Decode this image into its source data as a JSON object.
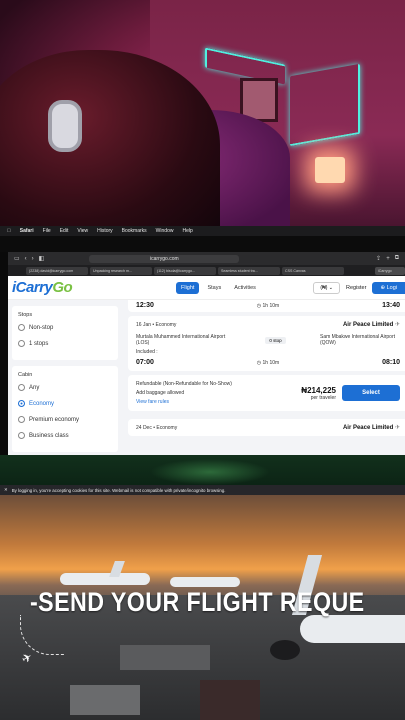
{
  "menubar": {
    "items": [
      "Safari",
      "File",
      "Edit",
      "View",
      "History",
      "Bookmarks",
      "Window",
      "Help"
    ]
  },
  "browser": {
    "url": "icarrygo.com",
    "tabs": [
      "(2238) david@icarrygo.com",
      "Unpacking research m...",
      "(112) bisola@icarrygo...",
      "Seamless student tra...",
      "CSS Canvas"
    ],
    "right_tab": "iCarrygo"
  },
  "site": {
    "logo_main": "iCarry",
    "logo_accent": "Go",
    "nav": [
      "Flight",
      "Stays",
      "Activities"
    ],
    "nav_active": "Flight",
    "currency": "(₦)",
    "register": "Register",
    "login": "Logi"
  },
  "sidebar": {
    "stops_title": "Stops",
    "stops": [
      "Non-stop",
      "1 stops"
    ],
    "cabin_title": "Cabin",
    "cabin": [
      "Any",
      "Economy",
      "Premium economy",
      "Business class"
    ],
    "cabin_selected": "Economy"
  },
  "results": {
    "prev_card": {
      "depart_time": "12:30",
      "duration": "1h 10m",
      "arrive_time": "13:40"
    },
    "card": {
      "date": "16 Jan",
      "cabin": "Economy",
      "airline": "Air Peace Limited",
      "from": "Murtala Muhammed International Airport (LOS)",
      "stops": "0 stop",
      "to": "Sam Mbakwe International Airport (QOW)",
      "included": "Included :",
      "depart_time": "07:00",
      "duration": "1h 10m",
      "arrive_time": "08:10",
      "refund": "Refundable (Non-Refundable for No-Show)",
      "baggage": "Add baggage allowed",
      "fare_rules": "View fare rules",
      "price": "₦214,225",
      "per": "per traveler",
      "select": "Select"
    },
    "next_card": {
      "date": "24 Dec",
      "cabin": "Economy",
      "airline": "Air Peace Limited"
    }
  },
  "cookie": {
    "text": "By logging in, you're accepting cookies for this site. Webmail is not compatible with private/incognito browsing."
  },
  "banner": {
    "text": "-SEND YOUR FLIGHT REQUE"
  }
}
